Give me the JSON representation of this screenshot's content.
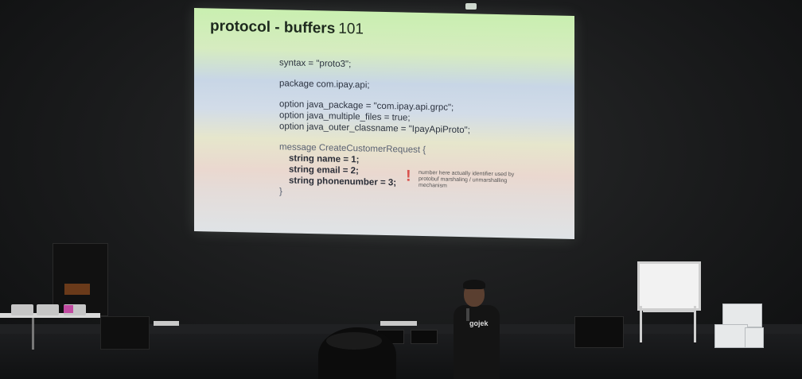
{
  "slide": {
    "title_bold": "protocol - buffers",
    "title_num": "101",
    "code_lines": [
      "syntax = \"proto3\";",
      "",
      "package com.ipay.api;",
      "",
      "option java_package = \"com.ipay.api.grpc\";",
      "option java_multiple_files = true;",
      "option java_outer_classname = \"IpayApiProto\";",
      "",
      "message CreateCustomerRequest {",
      "string name = 1;",
      "string email = 2;",
      "string phonenumber = 3;",
      "}"
    ],
    "note": "number here actually identifier used by protobuf marshaling / unmarshalling mechanism",
    "note_mark": "!"
  },
  "presenter": {
    "shirt_text": "gojek"
  },
  "colors": {
    "room": "#151617",
    "screen_top": "#c9efb0",
    "screen_mid": "#c8d6e6",
    "screen_bottom": "#dfe3e6",
    "title_text": "#1e2a1e",
    "accent_mark": "#d9534f"
  }
}
